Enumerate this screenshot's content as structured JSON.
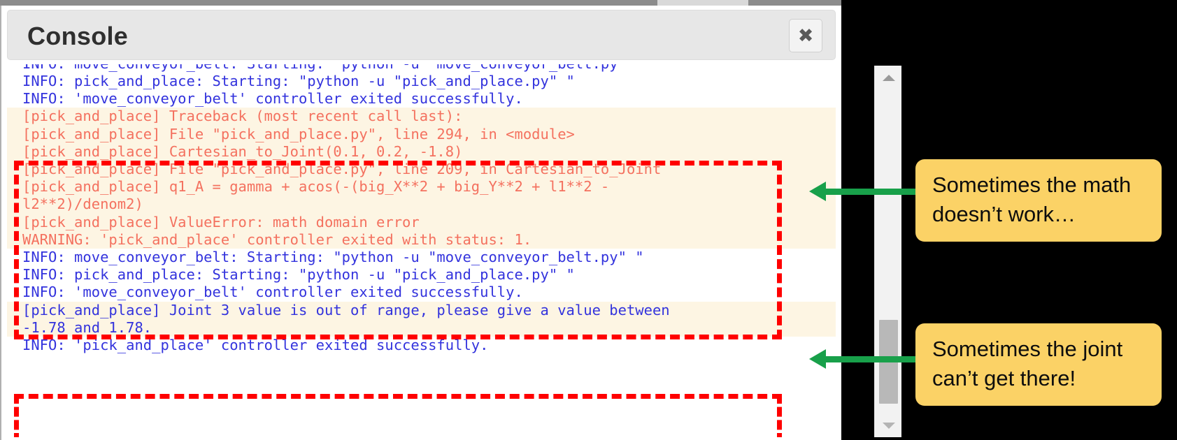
{
  "window": {
    "title": "Console",
    "close_label": "✖",
    "close_icon": "close-icon"
  },
  "scrollbar": {
    "up_arrow": "scroll-up-arrow",
    "down_arrow": "scroll-down-arrow",
    "thumb": "scroll-thumb"
  },
  "log": {
    "clipped_top_line": "INFO: move_conveyor_belt: Starting: \"python -u \"move_conveyor_belt.py\" \"",
    "lines_before": [
      {
        "text": "INFO: pick_and_place: Starting: \"python -u \"pick_and_place.py\" \"",
        "level": "info"
      },
      {
        "text": "INFO: 'move_conveyor_belt' controller exited successfully.",
        "level": "info"
      }
    ],
    "block1": [
      {
        "text": "[pick_and_place] Traceback (most recent call last):",
        "level": "error"
      },
      {
        "text": "[pick_and_place] File \"pick_and_place.py\", line 294, in <module>",
        "level": "error"
      },
      {
        "text": "[pick_and_place] Cartesian_to_Joint(0.1, 0.2, -1.8)",
        "level": "error"
      },
      {
        "text": "[pick_and_place] File \"pick_and_place.py\", line 209, in Cartesian_to_Joint",
        "level": "error"
      },
      {
        "text": "[pick_and_place] q1_A = gamma + acos(-(big_X**2 + big_Y**2 + l1**2 -",
        "level": "error"
      },
      {
        "text": "l2**2)/denom2)",
        "level": "error"
      },
      {
        "text": "[pick_and_place] ValueError: math domain error",
        "level": "error"
      },
      {
        "text": "WARNING: 'pick_and_place' controller exited with status: 1.",
        "level": "error"
      }
    ],
    "lines_middle": [
      {
        "text": "INFO: move_conveyor_belt: Starting: \"python -u \"move_conveyor_belt.py\" \"",
        "level": "info"
      },
      {
        "text": "INFO: pick_and_place: Starting: \"python -u \"pick_and_place.py\" \"",
        "level": "info"
      },
      {
        "text": "INFO: 'move_conveyor_belt' controller exited successfully.",
        "level": "info"
      }
    ],
    "block2": [
      {
        "text": "[pick_and_place] Joint 3 value is out of range, please give a value between",
        "level": "info"
      },
      {
        "text": "-1.78 and 1.78.",
        "level": "info"
      }
    ],
    "lines_after": [
      {
        "text": "INFO: 'pick_and_place' controller exited successfully.",
        "level": "info"
      }
    ]
  },
  "callouts": [
    {
      "text": "Sometimes the math\ndoesn’t work…"
    },
    {
      "text": "Sometimes the joint\ncan’t get there!"
    }
  ],
  "colors": {
    "info_text": "#3333dd",
    "error_text": "#f4715f",
    "highlight_bg": "#fdf5e3",
    "annotation_box": "#ff0000",
    "callout_bg": "#fbd266",
    "arrow": "#18a04a",
    "page_bg": "#000000"
  }
}
